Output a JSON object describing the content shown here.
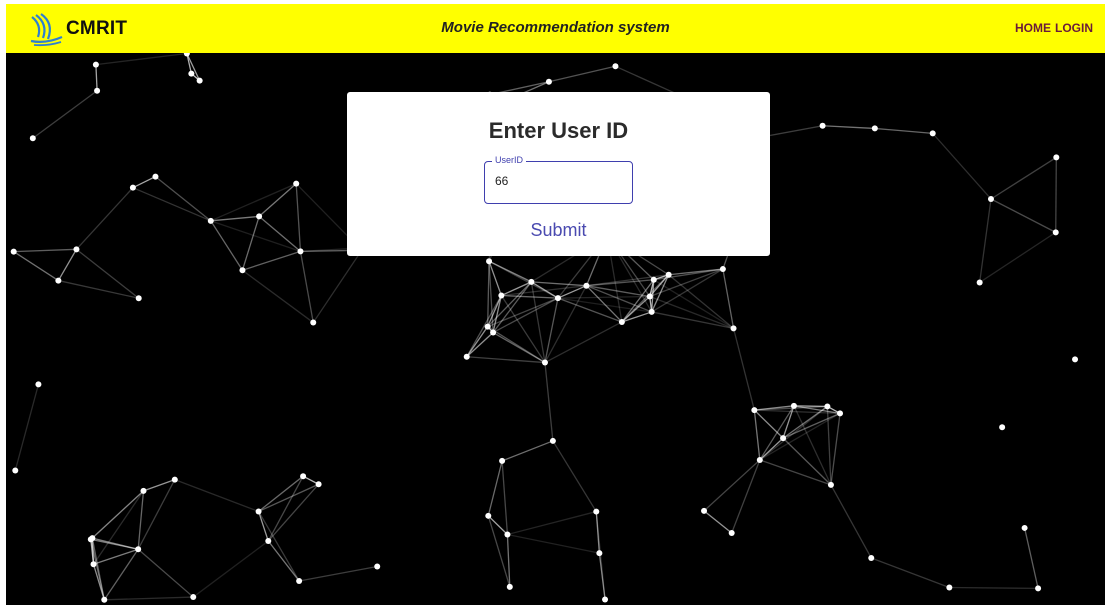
{
  "navbar": {
    "brand_name": "CMRIT",
    "brand_icon": "swan-logo-icon",
    "title": "Movie Recommendation system",
    "links": [
      "HOME",
      "LOGIN"
    ]
  },
  "form": {
    "title": "Enter User ID",
    "field_label": "UserID",
    "field_value": "66",
    "submit_label": "Submit"
  },
  "colors": {
    "navbar_bg": "#ffff00",
    "nav_link": "#6a1b3a",
    "accent": "#3f3fae",
    "background": "#000000"
  }
}
